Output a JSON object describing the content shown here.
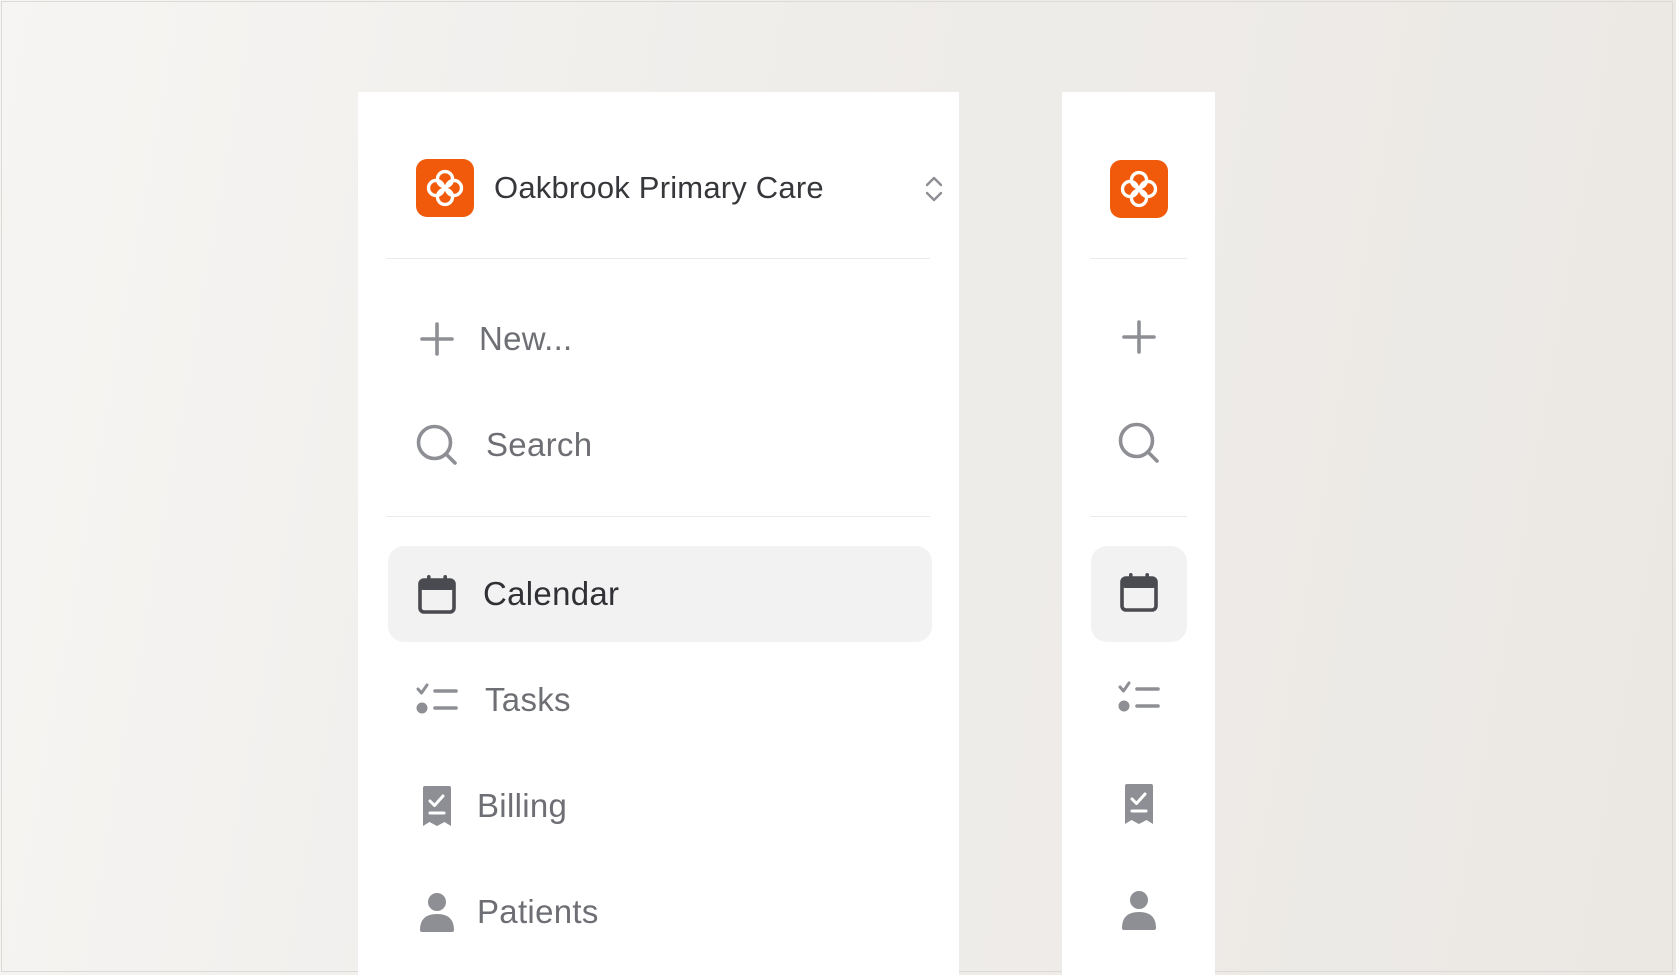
{
  "workspace": {
    "name": "Oakbrook Primary Care",
    "logo_icon": "clinic-logo-icon",
    "switcher_icon": "chevron-up-down-icon",
    "brand_color": "#F05A0A"
  },
  "actions": [
    {
      "label": "New...",
      "icon": "plus-icon"
    },
    {
      "label": "Search",
      "icon": "search-icon"
    }
  ],
  "nav": [
    {
      "label": "Calendar",
      "icon": "calendar-icon",
      "active": true
    },
    {
      "label": "Tasks",
      "icon": "checklist-icon",
      "active": false
    },
    {
      "label": "Billing",
      "icon": "receipt-icon",
      "active": false
    },
    {
      "label": "Patients",
      "icon": "user-icon",
      "active": false
    }
  ],
  "colors": {
    "active_background": "#F2F2F3",
    "icon_gray": "#8E8F94",
    "text_gray": "#6E6F74"
  }
}
